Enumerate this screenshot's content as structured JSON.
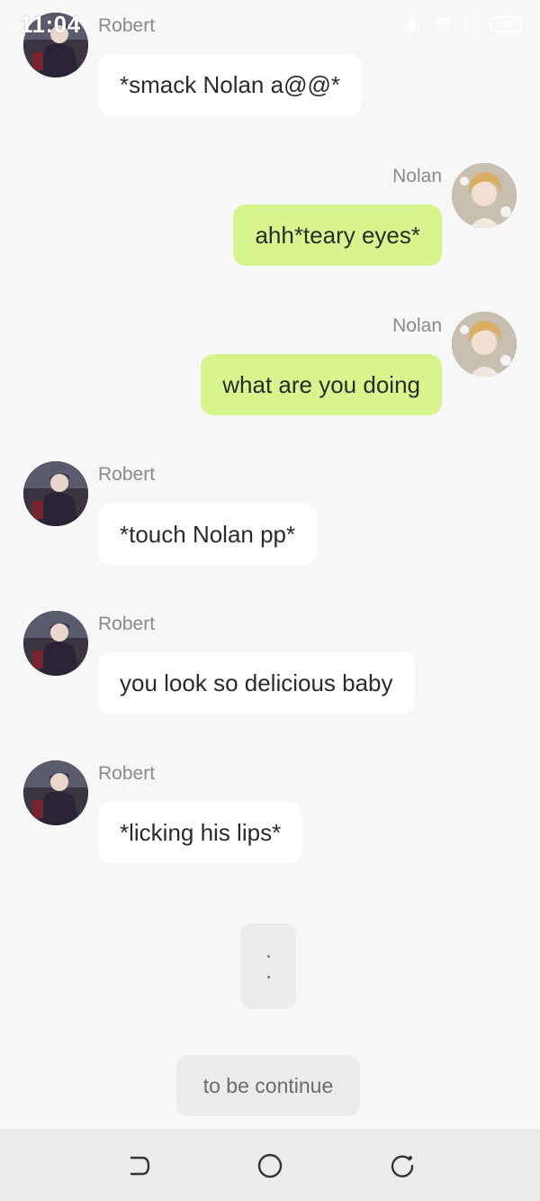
{
  "status_bar": {
    "time": "11:04",
    "network_speed_value": "1.5",
    "network_speed_unit": "K/s",
    "battery_level": "33"
  },
  "messages": [
    {
      "sender": "Robert",
      "side": "left",
      "text": "*smack Nolan a@@*"
    },
    {
      "sender": "Nolan",
      "side": "right",
      "text": "ahh*teary eyes*"
    },
    {
      "sender": "Nolan",
      "side": "right",
      "text": "what are you doing"
    },
    {
      "sender": "Robert",
      "side": "left",
      "text": "*touch Nolan pp*"
    },
    {
      "sender": "Robert",
      "side": "left",
      "text": "you look so delicious baby"
    },
    {
      "sender": "Robert",
      "side": "left",
      "text": "*licking his lips*"
    }
  ],
  "typing_indicator": {
    "visible": true
  },
  "continue_button": {
    "label": "to be continue"
  },
  "nav_bar": {
    "icons": [
      "back-icon",
      "home-icon",
      "recents-icon"
    ]
  },
  "colors": {
    "background": "#f7f7f7",
    "incoming_bubble": "#ffffff",
    "outgoing_bubble": "#d8f58d",
    "name_text": "#8a8a8a"
  }
}
